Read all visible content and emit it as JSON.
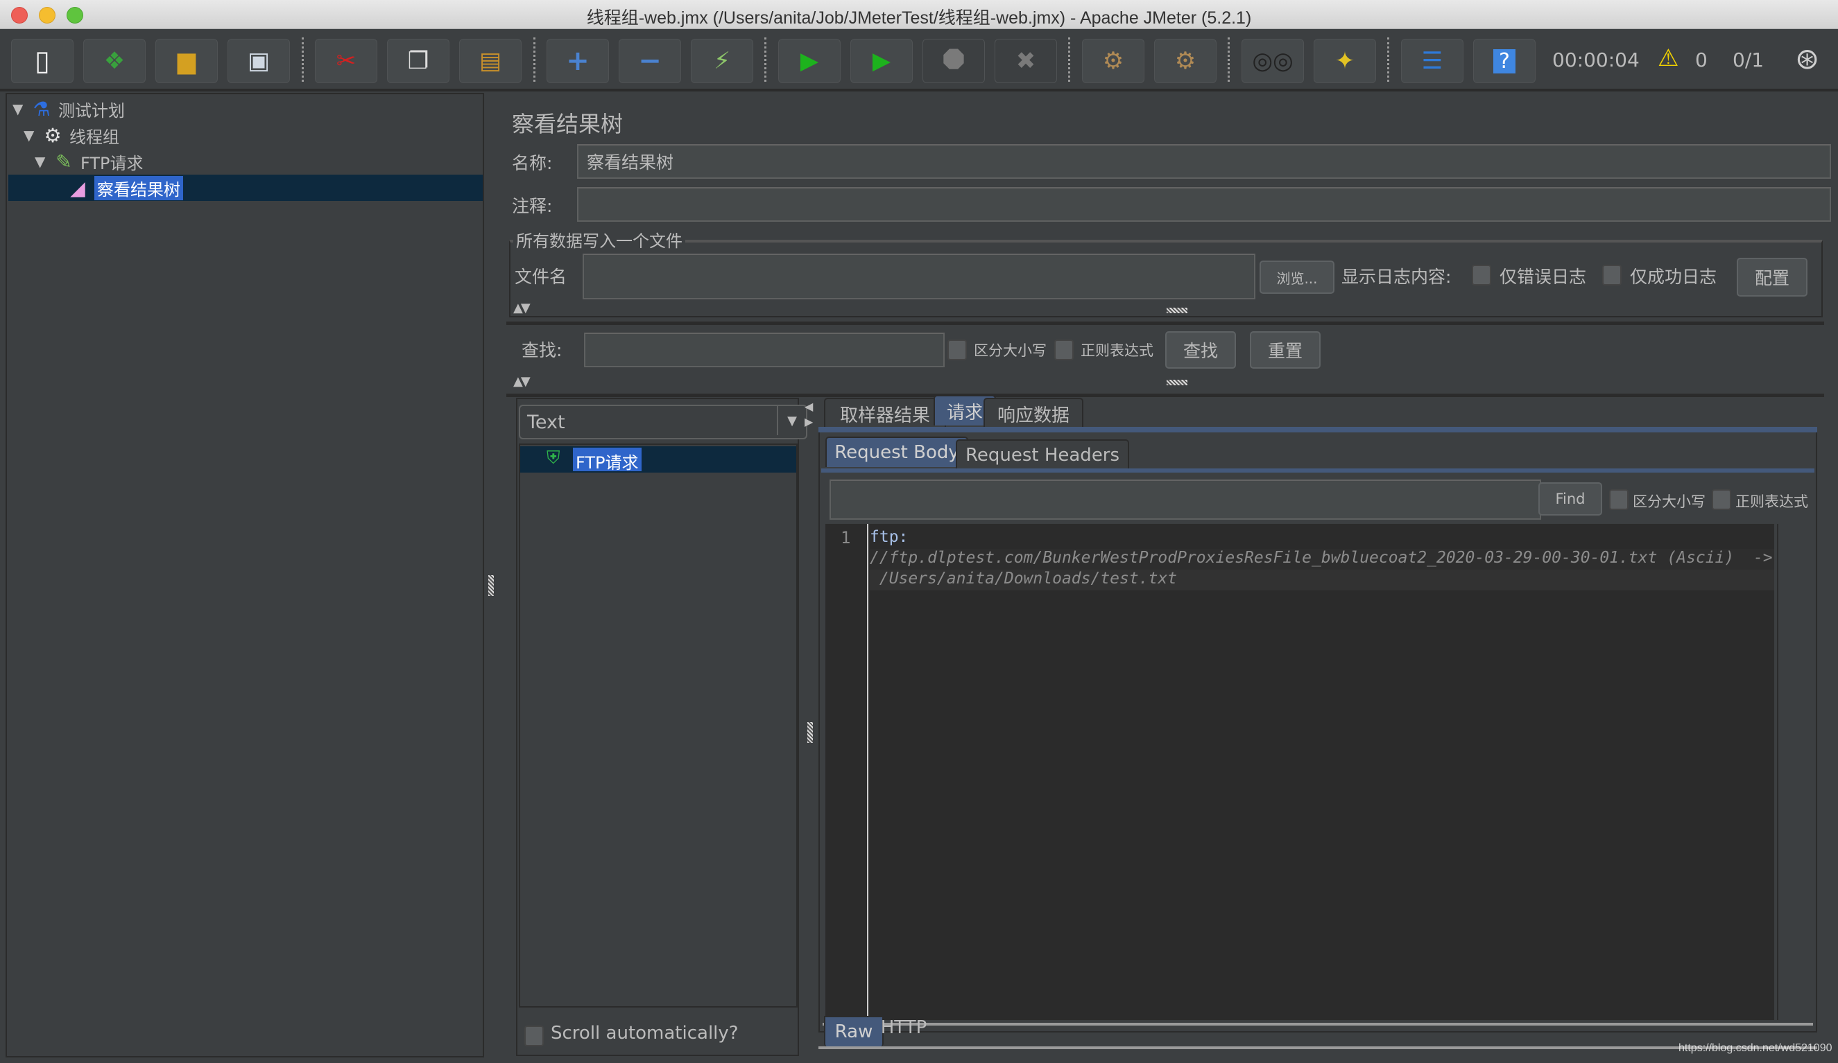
{
  "window": {
    "title": "线程组-web.jmx (/Users/anita/Job/JMeterTest/线程组-web.jmx) - Apache JMeter (5.2.1)"
  },
  "toolbar": {
    "buttons": [
      {
        "name": "new-icon",
        "glyph": "▯",
        "color": "#f2f2f2"
      },
      {
        "name": "templates-icon",
        "glyph": "❖",
        "color": "#39a13d"
      },
      {
        "name": "open-icon",
        "glyph": "📂",
        "color": "#d4a021"
      },
      {
        "name": "save-icon",
        "glyph": "💾",
        "color": "#9bb4d0"
      },
      {
        "name": "cut-icon",
        "glyph": "✂",
        "color": "#d42020"
      },
      {
        "name": "copy-icon",
        "glyph": "❐",
        "color": "#dddddd"
      },
      {
        "name": "paste-icon",
        "glyph": "📋",
        "color": "#c8902b"
      },
      {
        "name": "expand-icon",
        "glyph": "+",
        "color": "#4a82d0"
      },
      {
        "name": "collapse-icon",
        "glyph": "−",
        "color": "#4a82d0"
      },
      {
        "name": "toggle-icon",
        "glyph": "⚡",
        "color": "#8ec76a"
      },
      {
        "name": "start-icon",
        "glyph": "▶",
        "color": "#1db21d"
      },
      {
        "name": "start-no-pause-icon",
        "glyph": "▶",
        "color": "#1db21d"
      },
      {
        "name": "stop-icon",
        "glyph": "⯃",
        "color": "#7a7a7a"
      },
      {
        "name": "shutdown-icon",
        "glyph": "✖",
        "color": "#7a7a7a"
      },
      {
        "name": "clear-icon",
        "glyph": "🧹",
        "color": "#b08a55"
      },
      {
        "name": "clear-all-icon",
        "glyph": "🧹",
        "color": "#b08a55"
      },
      {
        "name": "search-icon",
        "glyph": "🔭",
        "color": "#222222"
      },
      {
        "name": "reset-search-icon",
        "glyph": "🧹",
        "color": "#e3c324"
      },
      {
        "name": "function-helper-icon",
        "glyph": "☰",
        "color": "#2f7ad8"
      },
      {
        "name": "help-icon",
        "glyph": "?",
        "color": "#ffffff"
      }
    ],
    "elapsed_time": "00:00:04",
    "warning_count": "0",
    "threads": "0/1"
  },
  "tree": {
    "items": [
      {
        "label": "测试计划",
        "icon": "flask-icon"
      },
      {
        "label": "线程组",
        "icon": "gear-icon"
      },
      {
        "label": "FTP请求",
        "icon": "dropper-icon"
      },
      {
        "label": "察看结果树",
        "icon": "graph-icon",
        "selected": true
      }
    ]
  },
  "panel": {
    "title": "察看结果树",
    "name_label": "名称:",
    "name_value": "察看结果树",
    "comment_label": "注释:",
    "comment_value": "",
    "file_group_title": "所有数据写入一个文件",
    "filename_label": "文件名",
    "filename_value": "",
    "browse_label": "浏览...",
    "log_label": "显示日志内容:",
    "errors_only_label": "仅错误日志",
    "success_only_label": "仅成功日志",
    "configure_label": "配置",
    "search_label": "查找:",
    "search_value": "",
    "case_sensitive_label": "区分大小写",
    "regex_label": "正则表达式",
    "find_button_label": "查找",
    "reset_button_label": "重置"
  },
  "results": {
    "renderer_selected": "Text",
    "samples": [
      {
        "label": "FTP请求",
        "status": "success"
      }
    ],
    "scroll_auto_label": "Scroll automatically?",
    "tabs": [
      "取样器结果",
      "请求",
      "响应数据"
    ],
    "active_tab": "请求",
    "subtabs": [
      "Request Body",
      "Request Headers"
    ],
    "active_subtab": "Request Body",
    "find_value": "",
    "find_button_label": "Find",
    "case_sensitive_label": "区分大小写",
    "regex_label": "正则表达式",
    "code": {
      "line_number": "1",
      "line1": "ftp:",
      "line2": "//ftp.dlptest.com/BunkerWestProdProxiesResFile_bwbluecoat2_2020-03-29-00-30-01.txt (Ascii)  ->",
      "line3": " /Users/anita/Downloads/test.txt"
    },
    "bottom_tabs": [
      "Raw",
      "HTTP"
    ],
    "active_bottom_tab": "Raw"
  },
  "watermark": "https://blog.csdn.net/wd521090"
}
